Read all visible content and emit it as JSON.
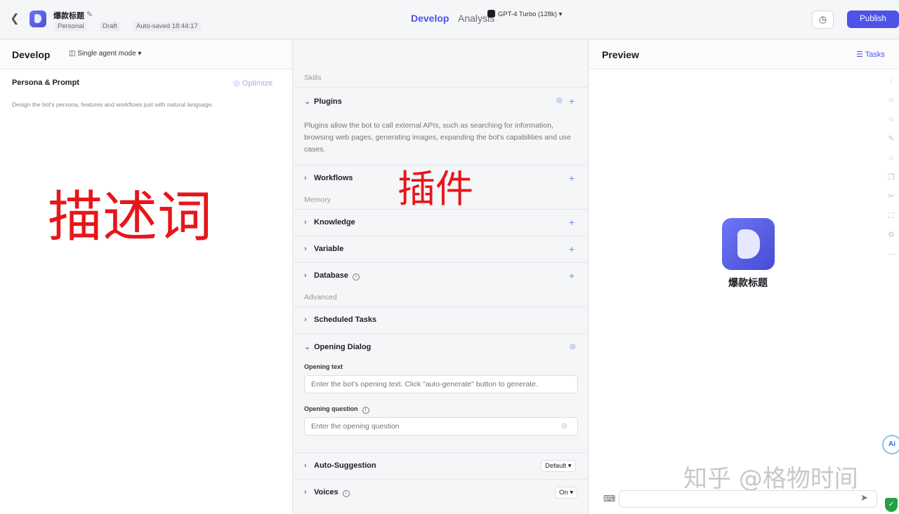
{
  "header": {
    "back_icon": "chevron-left-icon",
    "bot_name": "爆款标题",
    "tags": [
      "Personal",
      "Draft",
      "Auto-saved 18:44:17"
    ],
    "tabs": [
      {
        "label": "Develop",
        "active": true
      },
      {
        "label": "Analysis",
        "active": false
      }
    ],
    "publish_label": "Publish",
    "accent_color": "#4d53e8"
  },
  "develop": {
    "title": "Develop",
    "mode": "Single agent mode",
    "model": "GPT-4 Turbo (128k)",
    "persona": {
      "title": "Persona & Prompt",
      "optimize": "Optimize",
      "description": "Design the bot's persona, features and workflows just with natural language.",
      "overlay_text": "描述词"
    }
  },
  "skills": {
    "section_label": "Skills",
    "plugins": {
      "title": "Plugins",
      "description": "Plugins allow the bot to call external APIs, such as searching for information, browsing web pages, generating images, expanding the bot's capabilities and use cases.",
      "overlay_text": "插件"
    },
    "workflows": "Workflows"
  },
  "memory": {
    "section_label": "Memory",
    "knowledge": "Knowledge",
    "variable": "Variable",
    "database": "Database"
  },
  "advanced": {
    "section_label": "Advanced",
    "scheduled_tasks": "Scheduled Tasks",
    "opening_dialog": {
      "title": "Opening Dialog",
      "opening_text_label": "Opening text",
      "opening_text_placeholder": "Enter the bot's opening text. Click \"auto-generate\" button to generate.",
      "opening_question_label": "Opening question",
      "opening_question_placeholder": "Enter the opening question"
    },
    "auto_suggestion": {
      "title": "Auto-Suggestion",
      "value": "Default"
    },
    "voices": {
      "title": "Voices",
      "value": "On"
    }
  },
  "preview": {
    "title": "Preview",
    "tasks_label": "Tasks",
    "bot_name": "爆款标题",
    "watermark": "知乎 @格物时间",
    "ai_badge": "Ai"
  }
}
